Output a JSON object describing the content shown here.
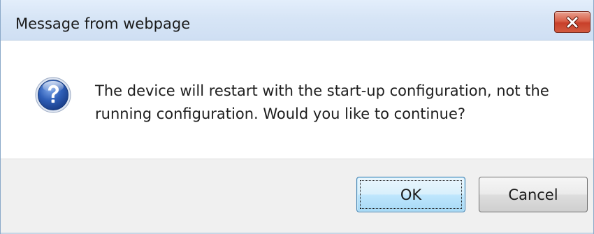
{
  "window": {
    "title": "Message from webpage",
    "close_icon": "close-x-icon"
  },
  "dialog": {
    "icon": "question-icon",
    "message": "The device will restart with the start-up configuration, not the running configuration. Would you like to continue?"
  },
  "buttons": {
    "ok_label": "OK",
    "cancel_label": "Cancel"
  },
  "colors": {
    "titlebar": "#d7e5f6",
    "close_button": "#d9614a",
    "footer": "#f0f0f0",
    "ok_button_focus": "#3c7fb1",
    "question_icon": "#2f5fb8"
  }
}
